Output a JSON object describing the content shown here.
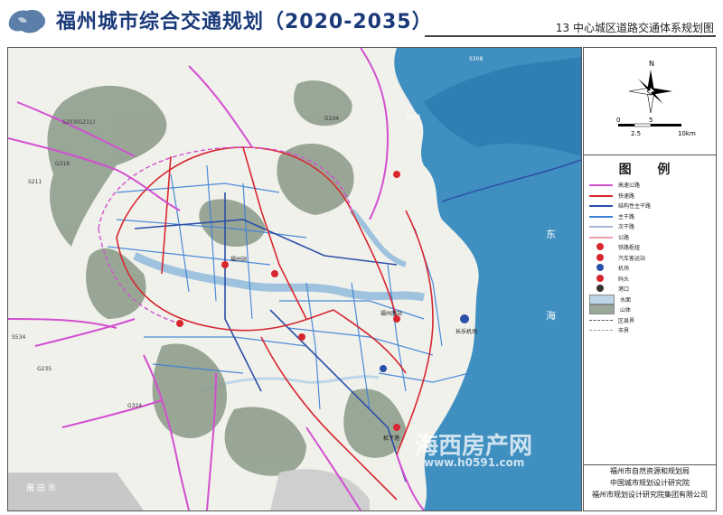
{
  "header": {
    "title": "福州城市综合交通规划（2020-2035）",
    "subtitle": "13 中心城区道路交通体系规划图"
  },
  "scale_bar": {
    "labels": [
      "0",
      "2.5",
      "5",
      "10km"
    ],
    "north": "N"
  },
  "legend": {
    "title": "图 例",
    "items": [
      {
        "label": "高速公路",
        "color": "#d24fd0"
      },
      {
        "label": "快速路",
        "color": "#d7262e"
      },
      {
        "label": "结构性主干路",
        "color": "#2c4fa8"
      },
      {
        "label": "主干路",
        "color": "#3a7fd8"
      },
      {
        "label": "次干路",
        "color": "#aab6d6"
      },
      {
        "label": "公路",
        "color": "#ef9aa8"
      },
      {
        "label": "铁路枢纽",
        "color": "#d7262e"
      },
      {
        "label": "汽车客运站",
        "color": "#d7262e"
      },
      {
        "label": "机场",
        "color": "#2c4fa8"
      },
      {
        "label": "码头",
        "color": "#d7262e"
      },
      {
        "label": "港口",
        "color": "#333333"
      },
      {
        "label": "水面",
        "color": "#bcd6e8"
      },
      {
        "label": "山体",
        "color": "#9aa89a"
      },
      {
        "label": "区县界",
        "color": "#555555"
      },
      {
        "label": "市界",
        "color": "#999999"
      }
    ]
  },
  "credits": [
    "福州市自然资源和规划局",
    "中国城市规划设计研究院",
    "福州市规划设计研究院集团有限公司"
  ],
  "map_labels": {
    "sea_1": "东",
    "sea_2": "海",
    "hwy_s308": "S308",
    "hwy_s203": "S203(G211)",
    "hwy_g316": "G316",
    "hwy_s211": "S211",
    "hwy_g104": "G104",
    "hwy_g228": "G228",
    "hwy_s534": "S534",
    "hwy_g235": "G235",
    "hwy_g324": "G324",
    "place_putian": "莆 田 市",
    "station_fuzhou": "福州站",
    "station_south": "福州南站",
    "airport": "长乐机场",
    "port": "松下港",
    "watermark": "海西房产网",
    "watermark_url": "www.h0591.com"
  }
}
